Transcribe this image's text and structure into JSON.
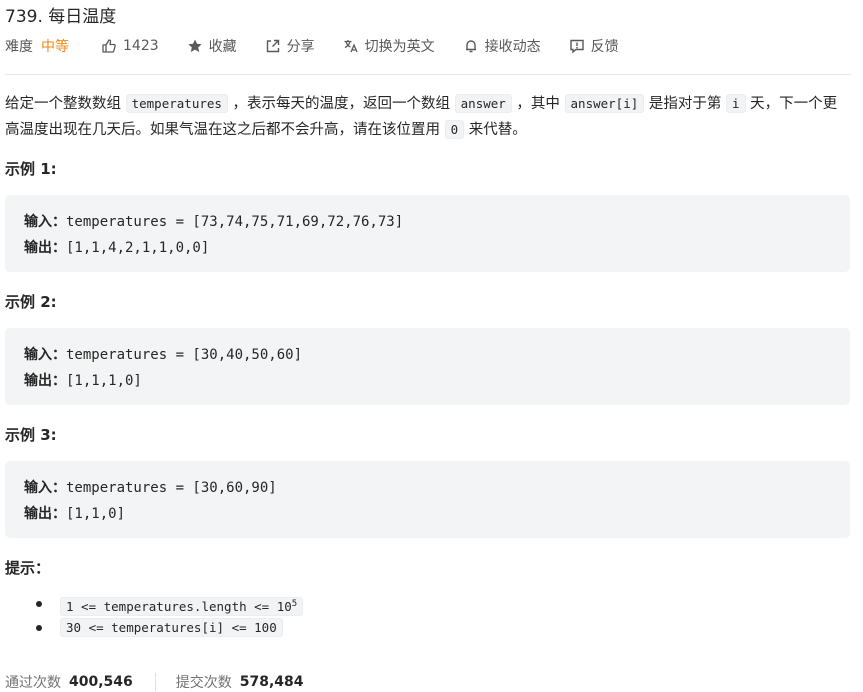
{
  "problem": {
    "title": "739. 每日温度"
  },
  "meta": {
    "difficulty_label": "难度",
    "difficulty_value": "中等",
    "likes": "1423",
    "favorite": "收藏",
    "share": "分享",
    "translate": "切换为英文",
    "subscribe": "接收动态",
    "feedback": "反馈"
  },
  "colors": {
    "difficulty_medium": "#ef8a1a",
    "code_bg": "#f3f4f5"
  },
  "description": {
    "p1": "给定一个整数数组 ",
    "code_temperatures": "temperatures",
    "p2": " ，表示每天的温度，返回一个数组 ",
    "code_answer": "answer",
    "p3": " ，其中 ",
    "code_answer_i": "answer[i]",
    "p4": " 是指对于第 ",
    "code_i": "i",
    "p5": " 天，下一个更高温度出现在几天后。如果气温在这之后都不会升高，请在该位置用 ",
    "code_zero": "0",
    "p6": " 来代替。"
  },
  "examples": [
    {
      "heading": "示例 1:",
      "input_label": "输入：",
      "input": "temperatures = [73,74,75,71,69,72,76,73]",
      "output_label": "输出：",
      "output": "[1,1,4,2,1,1,0,0]"
    },
    {
      "heading": "示例 2:",
      "input_label": "输入：",
      "input": "temperatures = [30,40,50,60]",
      "output_label": "输出：",
      "output": "[1,1,1,0]"
    },
    {
      "heading": "示例 3:",
      "input_label": "输入：",
      "input": "temperatures = [30,60,90]",
      "output_label": "输出：",
      "output": "[1,1,0]"
    }
  ],
  "hints": {
    "heading": "提示：",
    "h1_base": "1 <=  temperatures.length <= 10",
    "h1_sup": "5",
    "h2": "30 <=  temperatures[i]  <= 100"
  },
  "stats": {
    "accepted_label": "通过次数",
    "accepted_value": "400,546",
    "submitted_label": "提交次数",
    "submitted_value": "578,484"
  }
}
